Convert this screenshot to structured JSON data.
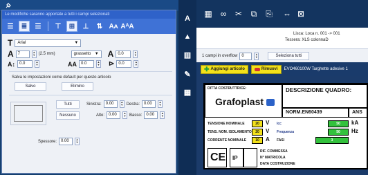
{
  "left_panel": {
    "header": "Le modifiche saranno apportate a tutti i campi selezionati",
    "font_name": "Arial",
    "font_size": "7",
    "font_size_mm": "(2.5 mm)",
    "style": "grassetto",
    "a_value": "0.0",
    "spacing": "0.0",
    "aa_value": "0.0",
    "rotate_value": "0.0",
    "default_note": "Salva le impostazioni come default per questo articolo",
    "save_label": "Salvo",
    "delete_label": "Elimino",
    "all_label": "Tutti",
    "none_label": "Nessuno",
    "left_label": "Sinistra:",
    "left_value": "0.00",
    "right_label": "Destra:",
    "right_value": "0.00",
    "top_label": "Alto:",
    "top_value": "0.00",
    "bottom_label": "Basso:",
    "bottom_value": "0.00",
    "thickness_label": "Spessore:",
    "thickness_value": "0.00"
  },
  "doc": {
    "line1": "Lisca: Loca n. 001 -> 001",
    "line2": "Tessera: XLS colonnaD"
  },
  "overflow": {
    "label": "1 campi in overflow",
    "value": "0",
    "select_all": "Seleziona tutti"
  },
  "actions": {
    "add": "Aggiungi articolo",
    "remove": "Rimuovi",
    "product": "EVO460100W Targhette adesive 1"
  },
  "label_card": {
    "manufacturer": "DITTA COSTRUTTRICE:",
    "brand": "Grafoplast",
    "description": "DESCRIZIONE QUADRO:",
    "norm": "NORM.EN60439",
    "ans": "ANS",
    "tensione": "TENSIONE NOMINALE",
    "tens_iso": "TENS. NOM. ISOLAMENTO",
    "corrente": "CORRENTE NOMINALE",
    "v1": "20",
    "v2": "20",
    "a1": "10",
    "unit_v": "V",
    "unit_a": "A",
    "icc": "Icc",
    "frequenza": "Frequenza",
    "fasi": "FASI",
    "g1": "50",
    "g2": "50",
    "g3": "3",
    "unit_ka": "kA",
    "unit_hz": "Hz",
    "ce": "CE",
    "ip": "IP",
    "rif": "RIF. COMMESSA",
    "matricola": "N° MATRICOLA",
    "data": "DATA COSTRUZIONE"
  },
  "colors": {
    "panel_blue": "#3f72d6",
    "dark_navy": "#0f2d55",
    "yellow": "#f3e11a",
    "green": "#33c13d"
  }
}
